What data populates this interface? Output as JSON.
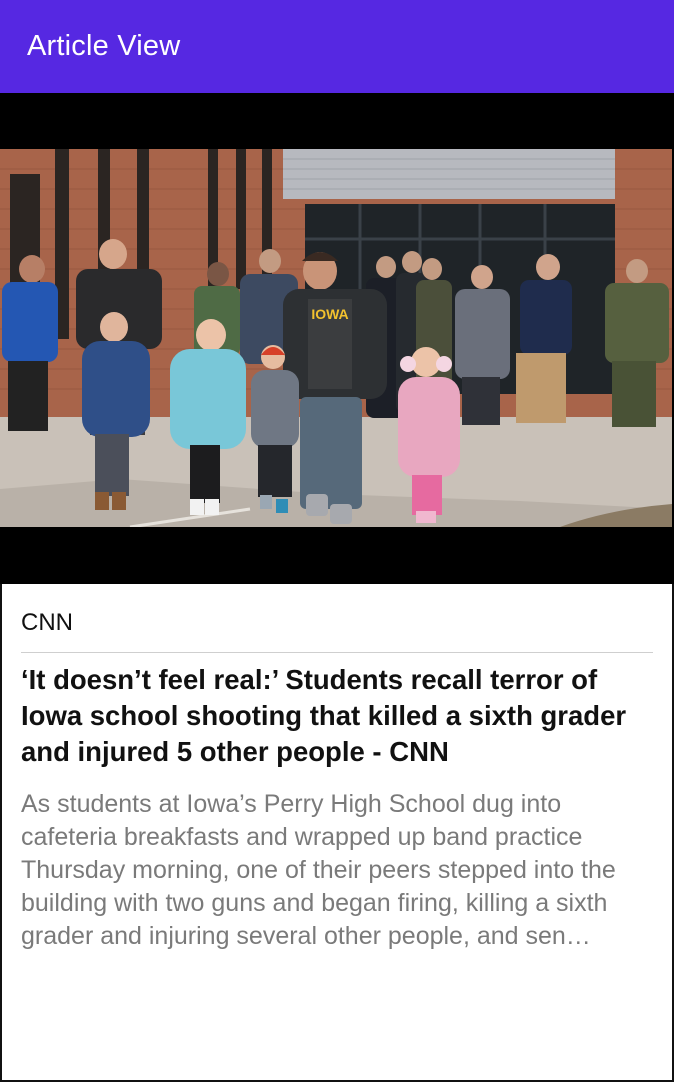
{
  "app_bar": {
    "title": "Article View"
  },
  "article": {
    "source": "CNN",
    "headline": "‘It doesn’t feel real:’ Students recall terror of Iowa school shooting that killed a sixth grader and injured 5 other people - CNN",
    "summary": "As students at Iowa’s Perry High School dug into cafeteria breakfasts and wrapped up band practice Thursday morning, one of their peers stepped into the building with two guns and began firing, killing a sixth grader and injuring several other people, and sen…",
    "image": {
      "shirt_text": "IOWA",
      "colors": {
        "brick": "#a8644a",
        "pavement": "#c9c1b8",
        "sky_panel": "#b7b9bf",
        "jacket_blue": "#2f4f88",
        "jacket_teal": "#79c7d8",
        "jacket_pink": "#e8a7c0"
      }
    }
  },
  "colors": {
    "app_bar_bg": "#5628E2",
    "summary_text": "#7a7a7a"
  }
}
